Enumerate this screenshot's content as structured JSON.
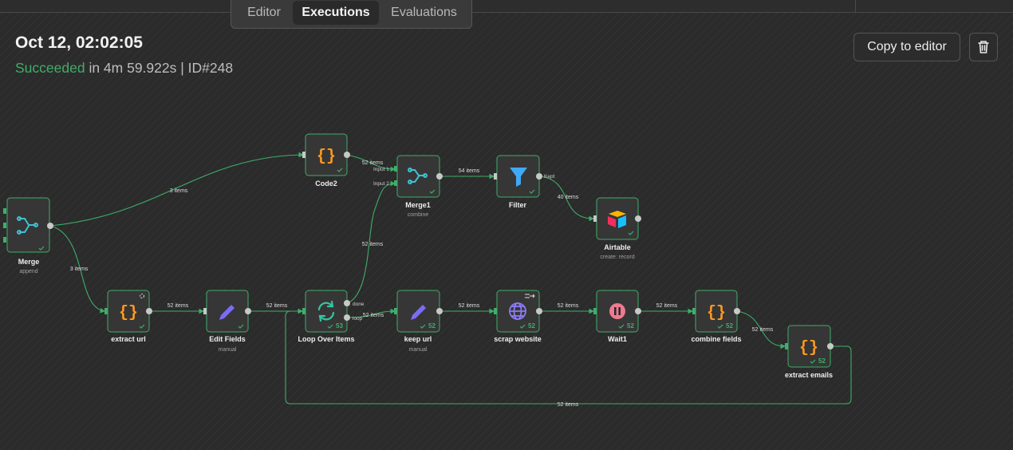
{
  "tabs": [
    {
      "label": "Editor"
    },
    {
      "label": "Executions"
    },
    {
      "label": "Evaluations"
    }
  ],
  "execution": {
    "title": "Oct 12, 02:02:05",
    "status": "Succeeded",
    "duration_text": " in 4m 59.922s | ID#248"
  },
  "actions": {
    "copy_label": "Copy to editor",
    "delete_icon": "trash-icon"
  },
  "colors": {
    "success": "#3fae6a",
    "connection": "#3fae6a",
    "node_border": "#3fae6a",
    "code_icon": "#ff9a1f",
    "merge_icon": "#3ec1d3",
    "filter_icon": "#3fa9f5",
    "edit_icon": "#7b6cf6",
    "wait_icon": "#ef7a90",
    "loop_icon": "#35c4a0",
    "globe_icon": "#8a7cf6"
  },
  "nodes": {
    "merge": {
      "label": "Merge",
      "sub": "append",
      "icon": "merge-icon"
    },
    "code2": {
      "label": "Code2",
      "icon": "code-braces-icon"
    },
    "merge1": {
      "label": "Merge1",
      "sub": "combine",
      "icon": "merge-icon",
      "input1": "Input 1",
      "input2": "Input 2"
    },
    "filter": {
      "label": "Filter",
      "icon": "filter-icon",
      "kept": "Kept"
    },
    "airtable": {
      "label": "Airtable",
      "sub": "create: record",
      "icon": "airtable-icon"
    },
    "extract_url": {
      "label": "extract url",
      "icon": "code-braces-icon"
    },
    "edit_fields": {
      "label": "Edit Fields",
      "sub": "manual",
      "icon": "pencil-icon"
    },
    "loop": {
      "label": "Loop Over Items",
      "icon": "loop-icon",
      "count": "53",
      "done": "done",
      "loop": "loop"
    },
    "keep_url": {
      "label": "keep url",
      "sub": "manual",
      "icon": "pencil-icon",
      "count": "52"
    },
    "scrap": {
      "label": "scrap website",
      "icon": "globe-icon",
      "count": "52"
    },
    "wait1": {
      "label": "Wait1",
      "icon": "pause-icon",
      "count": "52"
    },
    "combine": {
      "label": "combine fields",
      "icon": "code-braces-icon",
      "count": "52"
    },
    "extract_emails": {
      "label": "extract emails",
      "icon": "code-braces-icon",
      "count": "52"
    }
  },
  "edges": {
    "merge_code2": "3 items",
    "merge_extract": "3 items",
    "code2_merge1": "52 items",
    "merge1_filter": "54 items",
    "filter_airtable": "40 items",
    "extract_edit": "52 items",
    "edit_loop": "52 items",
    "loop_merge1": "52 items",
    "loop_keep": "52 items",
    "keep_scrap": "52 items",
    "scrap_wait": "52 items",
    "wait_combine": "52 items",
    "combine_emails": "52 items",
    "emails_loop": "52 items"
  }
}
